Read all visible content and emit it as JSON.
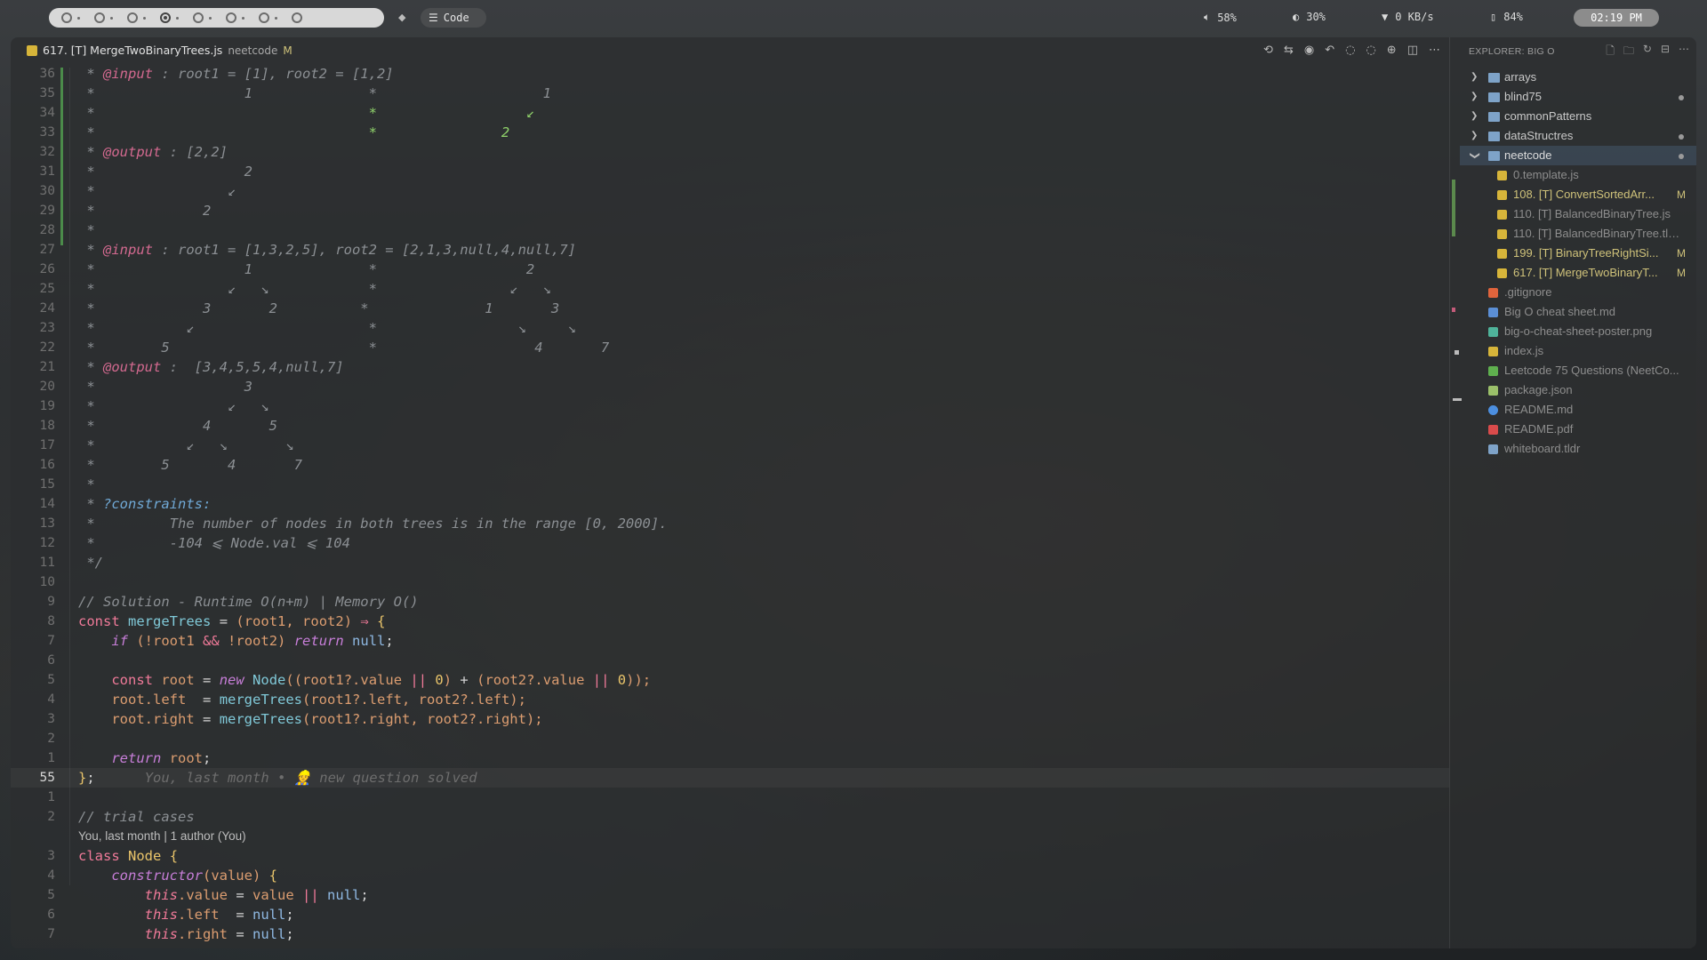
{
  "topbar": {
    "mode_label": "Code",
    "volume": "58%",
    "brightness": "30%",
    "network": "0 KB/s",
    "battery": "84%",
    "clock": "02:19 PM"
  },
  "tab": {
    "title": "617. [T] MergeTwoBinaryTrees.js",
    "folder": "neetcode",
    "status": "M"
  },
  "code_lines": [
    {
      "ln": "36",
      "html": "<span class=\"c-com\"> * </span><span class=\"c-tag\">@input</span><span class=\"c-com\"> : root1 = [1], root2 = [1,2]</span>"
    },
    {
      "ln": "35",
      "html": "<span class=\"c-com\"> *                  1              *                    1</span>"
    },
    {
      "ln": "34",
      "html": "<span class=\"c-com\"> *                                 </span><span class=\"c-grn\">*                  ↙</span>"
    },
    {
      "ln": "33",
      "html": "<span class=\"c-com\"> *                                 </span><span class=\"c-grn\">*               2</span>"
    },
    {
      "ln": "32",
      "html": "<span class=\"c-com\"> * </span><span class=\"c-tag\">@output</span><span class=\"c-com\"> : [2,2]</span>"
    },
    {
      "ln": "31",
      "html": "<span class=\"c-com\"> *                  2</span>"
    },
    {
      "ln": "30",
      "html": "<span class=\"c-com\"> *                ↙</span>"
    },
    {
      "ln": "29",
      "html": "<span class=\"c-com\"> *             2</span>"
    },
    {
      "ln": "28",
      "html": "<span class=\"c-com\"> *</span>"
    },
    {
      "ln": "27",
      "html": "<span class=\"c-com\"> * </span><span class=\"c-tag\">@input</span><span class=\"c-com\"> : root1 = [1,3,2,5], root2 = [2,1,3,null,4,null,7]</span>"
    },
    {
      "ln": "26",
      "html": "<span class=\"c-com\"> *                  1              *                  2</span>"
    },
    {
      "ln": "25",
      "html": "<span class=\"c-com\"> *                ↙   ↘            *                ↙   ↘</span>"
    },
    {
      "ln": "24",
      "html": "<span class=\"c-com\"> *             3       2          *              1       3</span>"
    },
    {
      "ln": "23",
      "html": "<span class=\"c-com\"> *           ↙                     *                 ↘     ↘</span>"
    },
    {
      "ln": "22",
      "html": "<span class=\"c-com\"> *        5                        *                   4       7</span>"
    },
    {
      "ln": "21",
      "html": "<span class=\"c-com\"> * </span><span class=\"c-tag\">@output</span><span class=\"c-com\"> :  [3,4,5,5,4,null,7]</span>"
    },
    {
      "ln": "20",
      "html": "<span class=\"c-com\"> *                  3</span>"
    },
    {
      "ln": "19",
      "html": "<span class=\"c-com\"> *                ↙   ↘</span>"
    },
    {
      "ln": "18",
      "html": "<span class=\"c-com\"> *             4       5</span>"
    },
    {
      "ln": "17",
      "html": "<span class=\"c-com\"> *           ↙   ↘       ↘</span>"
    },
    {
      "ln": "16",
      "html": "<span class=\"c-com\"> *        5       4       7</span>"
    },
    {
      "ln": "15",
      "html": "<span class=\"c-com\"> *</span>"
    },
    {
      "ln": "14",
      "html": "<span class=\"c-com\"> * </span><span class=\"c-tag2\">?constraints:</span>"
    },
    {
      "ln": "13",
      "html": "<span class=\"c-com\"> *         The number of nodes in both trees is in the range [0, 2000].</span>"
    },
    {
      "ln": "12",
      "html": "<span class=\"c-com\"> *         -104 ⩽ Node.val ⩽ 104</span>"
    },
    {
      "ln": "11",
      "html": "<span class=\"c-com\"> */</span>"
    },
    {
      "ln": "10",
      "html": ""
    },
    {
      "ln": "9",
      "html": "<span class=\"c-com\">// Solution - Runtime O(n+m) | Memory O()</span>"
    },
    {
      "ln": "8",
      "html": "<span class=\"c-kw\">const</span> <span class=\"c-fn\">mergeTrees</span> <span class=\"c-plain\">=</span> <span class=\"c-var\">(root1, root2)</span> <span class=\"c-kw\">⇒</span> <span class=\"c-num\">{</span>"
    },
    {
      "ln": "7",
      "html": "    <span class=\"c-kwi\">if</span> <span class=\"c-var\">(!root1</span> <span class=\"c-kw\">&&</span> <span class=\"c-var\">!root2)</span> <span class=\"c-kwi\">return</span> <span class=\"c-null\">null</span><span class=\"c-plain\">;</span>"
    },
    {
      "ln": "6",
      "html": ""
    },
    {
      "ln": "5",
      "html": "    <span class=\"c-kw\">const</span> <span class=\"c-var\">root</span> <span class=\"c-plain\">=</span> <span class=\"c-kwi\">new</span> <span class=\"c-fn\">Node</span><span class=\"c-var\">((root1?.value</span> <span class=\"c-kw\">||</span> <span class=\"c-num\">0</span><span class=\"c-var\">)</span> <span class=\"c-plain\">+</span> <span class=\"c-var\">(root2?.value</span> <span class=\"c-kw\">||</span> <span class=\"c-num\">0</span><span class=\"c-var\">));</span>"
    },
    {
      "ln": "4",
      "html": "    <span class=\"c-var\">root.left</span>  <span class=\"c-plain\">=</span> <span class=\"c-fn\">mergeTrees</span><span class=\"c-var\">(root1?.left, root2?.left);</span>"
    },
    {
      "ln": "3",
      "html": "    <span class=\"c-var\">root.right</span> <span class=\"c-plain\">=</span> <span class=\"c-fn\">mergeTrees</span><span class=\"c-var\">(root1?.right, root2?.right);</span>"
    },
    {
      "ln": "2",
      "html": ""
    },
    {
      "ln": "1",
      "html": "    <span class=\"c-kwi\">return</span> <span class=\"c-var\">root</span><span class=\"c-plain\">;</span>"
    },
    {
      "ln": "55",
      "current": true,
      "html": "<span class=\"c-num\">}</span><span class=\"c-plain\">;</span>      <span class=\"c-blame\">You, last month • 👷 new question solved</span>"
    },
    {
      "ln": "1",
      "html": ""
    },
    {
      "ln": "2",
      "html": "<span class=\"c-com\">// trial cases</span>"
    },
    {
      "ln": "",
      "meta": "You, last month | 1 author (You)"
    },
    {
      "ln": "3",
      "html": "<span class=\"c-kw\">class</span> <span class=\"c-cls\">Node</span> <span class=\"c-num\">{</span>"
    },
    {
      "ln": "4",
      "html": "    <span class=\"c-kwi\">constructor</span><span class=\"c-var\">(value)</span> <span class=\"c-num\">{</span>"
    },
    {
      "ln": "5",
      "html": "        <span class=\"c-this\">this</span><span class=\"c-var\">.value</span> <span class=\"c-plain\">=</span> <span class=\"c-var\">value</span> <span class=\"c-kw\">||</span> <span class=\"c-null\">null</span><span class=\"c-plain\">;</span>"
    },
    {
      "ln": "6",
      "html": "        <span class=\"c-this\">this</span><span class=\"c-var\">.left</span>  <span class=\"c-plain\">=</span> <span class=\"c-null\">null</span><span class=\"c-plain\">;</span>"
    },
    {
      "ln": "7",
      "html": "        <span class=\"c-this\">this</span><span class=\"c-var\">.right</span> <span class=\"c-plain\">=</span> <span class=\"c-null\">null</span><span class=\"c-plain\">;</span>"
    }
  ],
  "explorer": {
    "title": "EXPLORER: BIG O",
    "items": [
      {
        "label": "arrays",
        "type": "folder",
        "chevron": "›",
        "dot": false
      },
      {
        "label": "blind75",
        "type": "folder",
        "chevron": "›",
        "dot": true
      },
      {
        "label": "commonPatterns",
        "type": "folder",
        "chevron": "›",
        "dot": false
      },
      {
        "label": "dataStructres",
        "type": "folder",
        "chevron": "›",
        "dot": true
      },
      {
        "label": "neetcode",
        "type": "folder-open",
        "chevron": "⌄",
        "dot": true,
        "selected": true
      },
      {
        "label": "0.template.js",
        "type": "js",
        "indent": true,
        "style": "muted"
      },
      {
        "label": "108. [T] ConvertSortedArr...",
        "type": "js",
        "indent": true,
        "style": "mod",
        "status": "M"
      },
      {
        "label": "110. [T] BalancedBinaryTree.js",
        "type": "js",
        "indent": true,
        "style": "muted"
      },
      {
        "label": "110. [T] BalancedBinaryTree.tld...",
        "type": "tldr",
        "indent": true,
        "style": "muted"
      },
      {
        "label": "199. [T] BinaryTreeRightSi...",
        "type": "js",
        "indent": true,
        "style": "mod",
        "status": "M"
      },
      {
        "label": "617. [T] MergeTwoBinaryT...",
        "type": "js",
        "indent": true,
        "style": "mod",
        "status": "M"
      },
      {
        "label": ".gitignore",
        "type": "git",
        "style": "muted"
      },
      {
        "label": "Big O cheat sheet.md",
        "type": "md",
        "style": "muted"
      },
      {
        "label": "big-o-cheat-sheet-poster.png",
        "type": "png",
        "style": "muted"
      },
      {
        "label": "index.js",
        "type": "js",
        "style": "muted"
      },
      {
        "label": "Leetcode 75 Questions (NeetCo...",
        "type": "xlsx",
        "style": "muted"
      },
      {
        "label": "package.json",
        "type": "json",
        "style": "muted"
      },
      {
        "label": "README.md",
        "type": "info",
        "style": "muted"
      },
      {
        "label": "README.pdf",
        "type": "pdf",
        "style": "muted"
      },
      {
        "label": "whiteboard.tldr",
        "type": "file",
        "style": "muted"
      }
    ]
  }
}
